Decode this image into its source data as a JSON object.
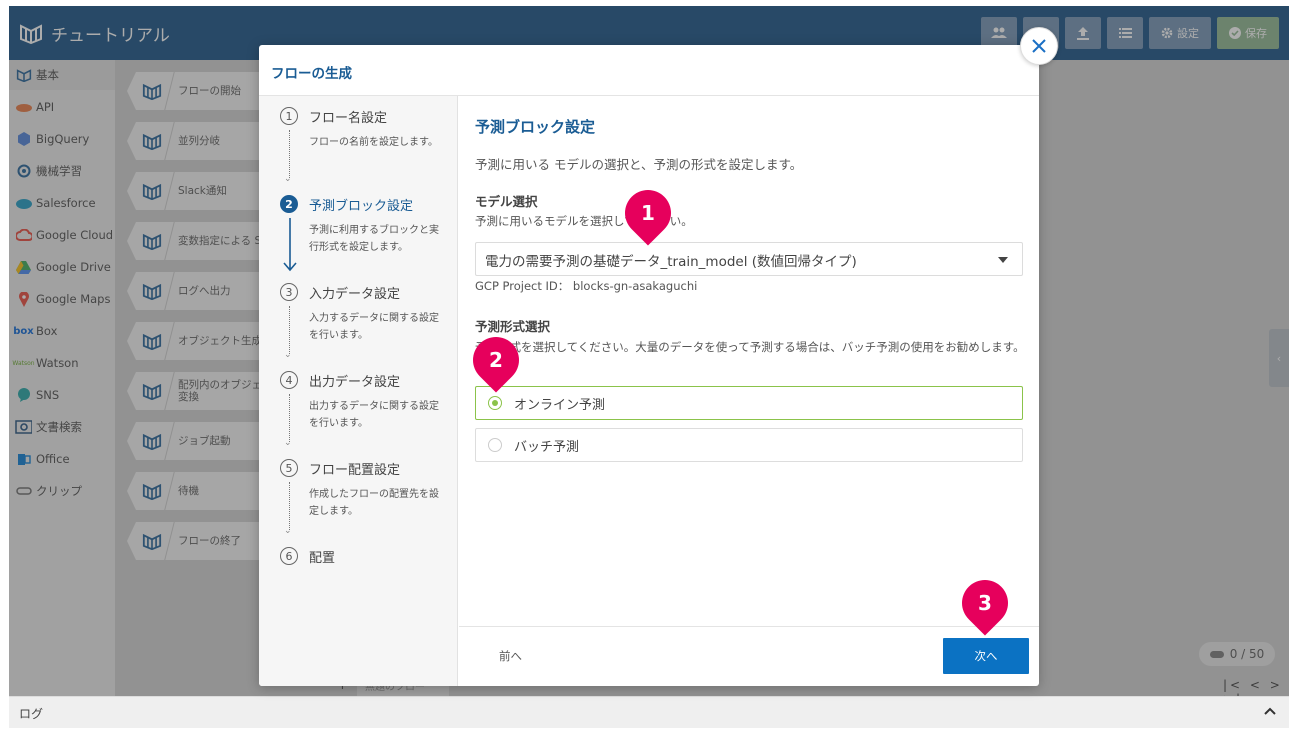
{
  "app": {
    "title": "チュートリアル",
    "settings_label": "設定",
    "save_label": "保存"
  },
  "sidebar": {
    "items": [
      {
        "label": "基本",
        "icon": "flow-icon"
      },
      {
        "label": "API",
        "icon": "api-icon"
      },
      {
        "label": "BigQuery",
        "icon": "bigquery-icon"
      },
      {
        "label": "機械学習",
        "icon": "ml-icon"
      },
      {
        "label": "Salesforce",
        "icon": "salesforce-icon"
      },
      {
        "label": "Google Cloud",
        "icon": "google-cloud-icon"
      },
      {
        "label": "Google Drive",
        "icon": "google-drive-icon"
      },
      {
        "label": "Google Maps",
        "icon": "google-maps-icon"
      },
      {
        "label": "Box",
        "icon": "box-icon"
      },
      {
        "label": "Watson",
        "icon": "watson-icon"
      },
      {
        "label": "SNS",
        "icon": "sns-icon"
      },
      {
        "label": "文書検索",
        "icon": "doc-search-icon"
      },
      {
        "label": "Office",
        "icon": "office-icon"
      },
      {
        "label": "クリップ",
        "icon": "clip-icon"
      }
    ]
  },
  "blocks": [
    {
      "label": "フローの開始"
    },
    {
      "label": "並列分岐"
    },
    {
      "label": "Slack通知"
    },
    {
      "label": "変数指定による S"
    },
    {
      "label": "ログへ出力"
    },
    {
      "label": "オブジェクト生成"
    },
    {
      "label": "配列内のオブジェ\n変換"
    },
    {
      "label": "ジョブ起動"
    },
    {
      "label": "待機"
    },
    {
      "label": "フローの終了"
    }
  ],
  "canvas": {
    "counter": "0 / 50",
    "pager": "|< < > >|",
    "tab_label": "無題のフロー",
    "plus": "+"
  },
  "log": {
    "label": "ログ"
  },
  "modal": {
    "title": "フローの生成",
    "steps": [
      {
        "num": "1",
        "title": "フロー名設定",
        "desc": "フローの名前を設定します。"
      },
      {
        "num": "2",
        "title": "予測ブロック設定",
        "desc": "予測に利用するブロックと実行形式を設定します。"
      },
      {
        "num": "3",
        "title": "入力データ設定",
        "desc": "入力するデータに関する設定を行います。"
      },
      {
        "num": "4",
        "title": "出力データ設定",
        "desc": "出力するデータに関する設定を行います。"
      },
      {
        "num": "5",
        "title": "フロー配置設定",
        "desc": "作成したフローの配置先を設定します。"
      },
      {
        "num": "6",
        "title": "配置",
        "desc": ""
      }
    ],
    "section_title": "予測ブロック設定",
    "intro": "予測に用いる モデルの選択と、予測の形式を設定します。",
    "model_label": "モデル選択",
    "model_help": "予測に用いるモデルを選択してください。",
    "model_value": "電力の需要予測の基礎データ_train_model (数値回帰タイプ)",
    "gcp_project": "GCP Project ID： blocks-gn-asakaguchi",
    "format_label": "予測形式選択",
    "format_help": "予測形式を選択してください。大量のデータを使って予測する場合は、バッチ予測の使用をお勧めします。",
    "options": [
      {
        "label": "オンライン予測",
        "selected": true
      },
      {
        "label": "バッチ予測",
        "selected": false
      }
    ],
    "prev_label": "前へ",
    "next_label": "次へ"
  },
  "callouts": [
    "1",
    "2",
    "3"
  ],
  "colors": {
    "brand": "#0f4c81",
    "accent": "#1a5c94",
    "primary_button": "#0b72c3",
    "selected": "#8bc34a",
    "callout": "#e6005c"
  }
}
